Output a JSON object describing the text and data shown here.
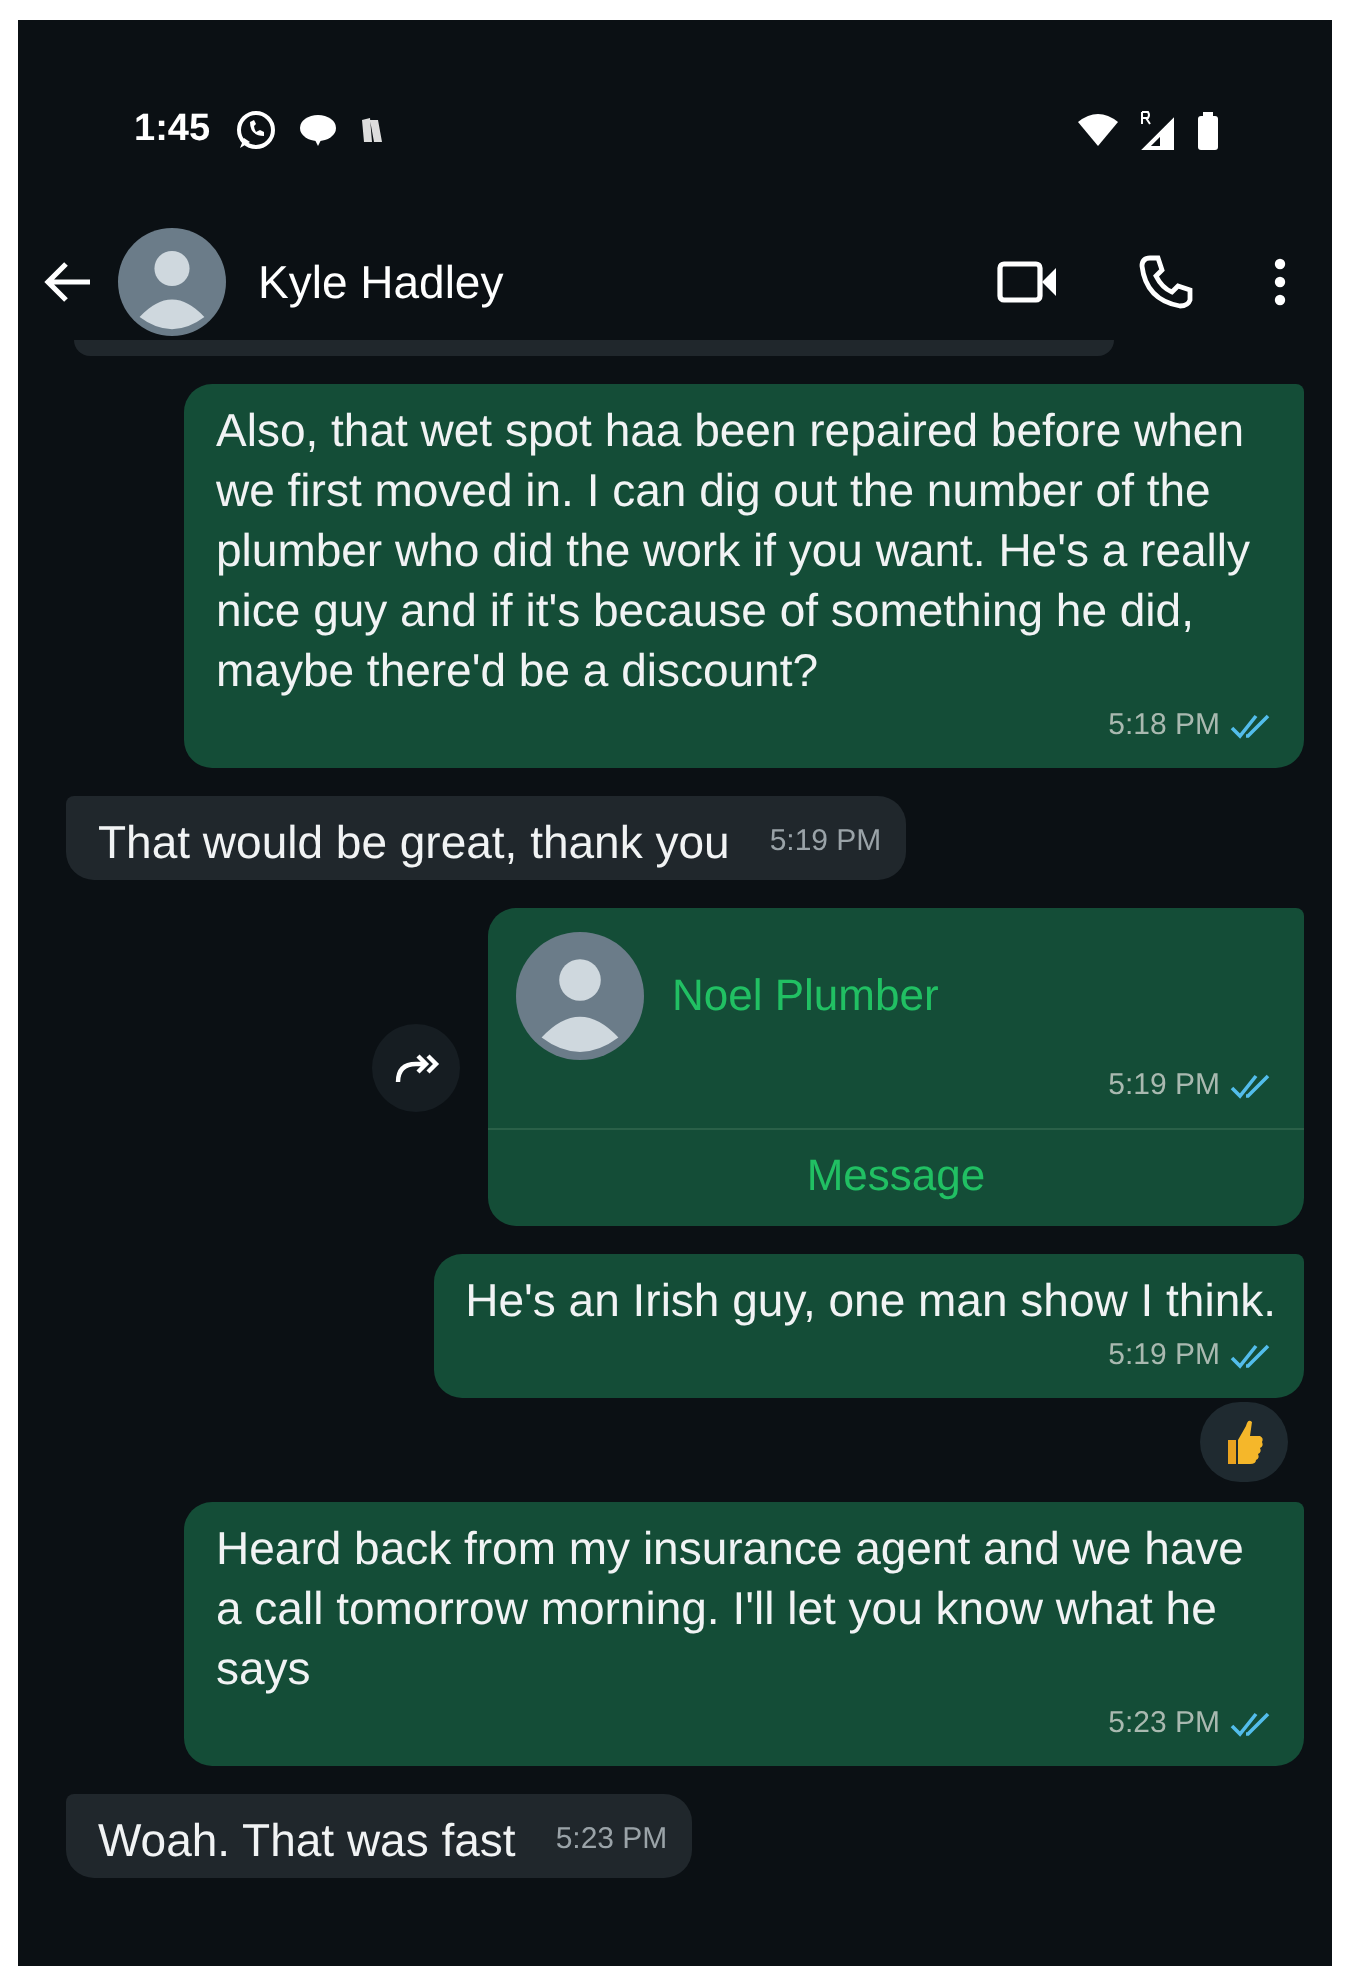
{
  "status_bar": {
    "time": "1:45"
  },
  "header": {
    "contact_name": "Kyle Hadley"
  },
  "messages": [
    {
      "kind": "partial"
    },
    {
      "kind": "out",
      "text": "Also, that wet spot haa been repaired before when we first moved in. I can dig out the number of the plumber who did the work if you want. He's a really nice guy and if it's because of something he did, maybe there'd be a discount?",
      "time": "5:18 PM",
      "read": true
    },
    {
      "kind": "in",
      "text": "That would be great, thank you",
      "time": "5:19 PM"
    },
    {
      "kind": "contact",
      "name": "Noel Plumber",
      "time": "5:19 PM",
      "read": true,
      "action": "Message"
    },
    {
      "kind": "out",
      "text": "He's an Irish guy, one man show I think.",
      "time": "5:19 PM",
      "read": true,
      "reacted": true
    },
    {
      "kind": "out",
      "text": "Heard back from my insurance agent and we have a call tomorrow morning. I'll let you know what he says",
      "time": "5:23 PM",
      "read": true
    },
    {
      "kind": "in",
      "text": "Woah. That was fast",
      "time": "5:23 PM"
    }
  ]
}
